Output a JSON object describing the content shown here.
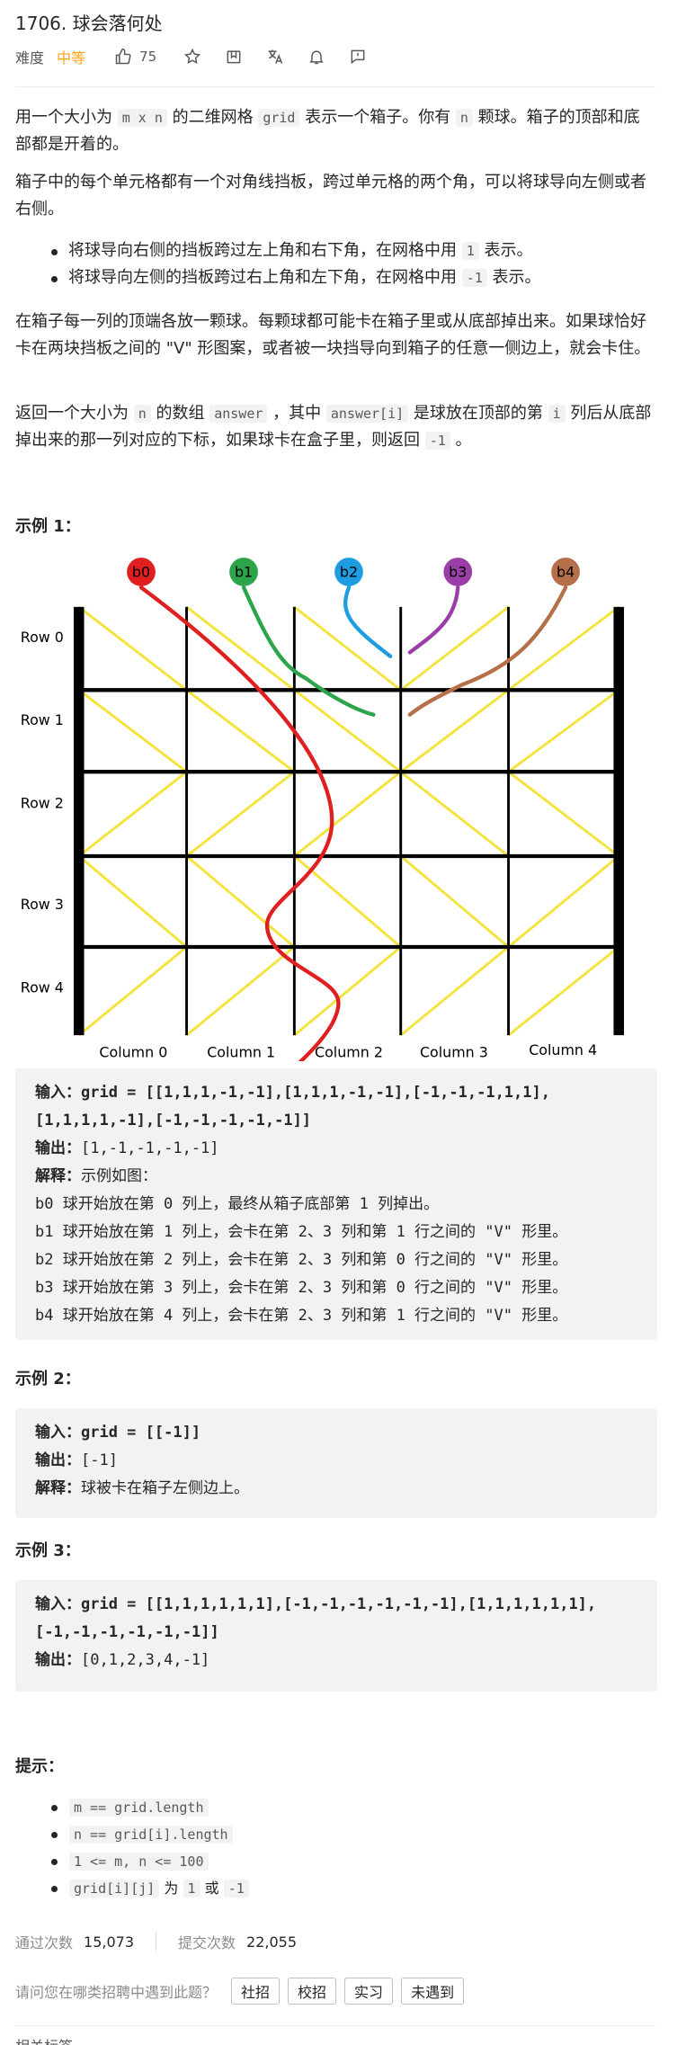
{
  "problem": {
    "title": "1706. 球会落何处",
    "difficulty_label": "难度",
    "difficulty": "中等",
    "likes": "75"
  },
  "description": {
    "p1": [
      "用一个大小为 ",
      "m x n",
      " 的二维网格 ",
      "grid",
      " 表示一个箱子。你有 ",
      "n",
      " 颗球。箱子的顶部和底部都是开着的。"
    ],
    "p2": "箱子中的每个单元格都有一个对角线挡板，跨过单元格的两个角，可以将球导向左侧或者右侧。",
    "bullets": [
      [
        "将球导向右侧的挡板跨过左上角和右下角，在网格中用 ",
        "1",
        " 表示。"
      ],
      [
        "将球导向左侧的挡板跨过右上角和左下角，在网格中用 ",
        "-1",
        " 表示。"
      ]
    ],
    "p3": "在箱子每一列的顶端各放一颗球。每颗球都可能卡在箱子里或从底部掉出来。如果球恰好卡在两块挡板之间的 \"V\" 形图案，或者被一块挡导向到箱子的任意一侧边上，就会卡住。",
    "p4": [
      "返回一个大小为 ",
      "n",
      " 的数组 ",
      "answer",
      " ，其中 ",
      "answer[i]",
      " 是球放在顶部的第 ",
      "i",
      " 列后从底部掉出来的那一列对应的下标，如果球卡在盒子里，则返回 ",
      "-1",
      " 。"
    ]
  },
  "example1": {
    "heading": "示例 1：",
    "figure": {
      "balls": [
        "b0",
        "b1",
        "b2",
        "b3",
        "b4"
      ],
      "ball_colors": [
        "#e02020",
        "#2ca44a",
        "#1e9ee0",
        "#9b3fa8",
        "#b5704a"
      ],
      "rows": [
        "Row 0",
        "Row 1",
        "Row 2",
        "Row 3",
        "Row 4"
      ],
      "columns": [
        "Column 0",
        "Column 1",
        "Column 2",
        "Column 3",
        "Column 4"
      ],
      "grid": [
        [
          1,
          1,
          1,
          -1,
          -1
        ],
        [
          1,
          1,
          1,
          -1,
          -1
        ],
        [
          -1,
          -1,
          -1,
          1,
          1
        ],
        [
          1,
          1,
          1,
          1,
          -1
        ],
        [
          -1,
          -1,
          -1,
          -1,
          -1
        ]
      ]
    },
    "input_label": "输入：",
    "input_line1": "grid = [[1,1,1,-1,-1],[1,1,1,-1,-1],[-1,-1,-1,1,1],",
    "input_line2": "[1,1,1,1,-1],[-1,-1,-1,-1,-1]]",
    "output_label": "输出：",
    "output": "[1,-1,-1,-1,-1]",
    "explain_label": "解释：",
    "explain": "示例如图：",
    "lines": [
      "b0 球开始放在第 0 列上，最终从箱子底部第 1 列掉出。",
      "b1 球开始放在第 1 列上，会卡在第 2、3 列和第 1 行之间的 \"V\" 形里。",
      "b2 球开始放在第 2 列上，会卡在第 2、3 列和第 0 行之间的 \"V\" 形里。",
      "b3 球开始放在第 3 列上，会卡在第 2、3 列和第 0 行之间的 \"V\" 形里。",
      "b4 球开始放在第 4 列上，会卡在第 2、3 列和第 1 行之间的 \"V\" 形里。"
    ]
  },
  "example2": {
    "heading": "示例 2：",
    "input_label": "输入：",
    "input": "grid = [[-1]]",
    "output_label": "输出：",
    "output": "[-1]",
    "explain_label": "解释：",
    "explain": "球被卡在箱子左侧边上。"
  },
  "example3": {
    "heading": "示例 3：",
    "input_label": "输入：",
    "input_line1": "grid = [[1,1,1,1,1,1],[-1,-1,-1,-1,-1,-1],[1,1,1,1,1,1],",
    "input_line2": "[-1,-1,-1,-1,-1,-1]]",
    "output_label": "输出：",
    "output": "[0,1,2,3,4,-1]"
  },
  "hints": {
    "heading": "提示：",
    "items": [
      [
        "m == grid.length"
      ],
      [
        "n == grid[i].length"
      ],
      [
        "1 <= m, n <= 100"
      ],
      [
        "grid[i][j]",
        " 为 ",
        "1",
        " 或 ",
        "-1"
      ]
    ]
  },
  "stats": {
    "accepted_label": "通过次数",
    "accepted": "15,073",
    "submissions_label": "提交次数",
    "submissions": "22,055"
  },
  "interview": {
    "question": "请问您在哪类招聘中遇到此题？",
    "tags": [
      "社招",
      "校招",
      "实习",
      "未遇到"
    ]
  },
  "footer": {
    "related": "相关标签"
  }
}
